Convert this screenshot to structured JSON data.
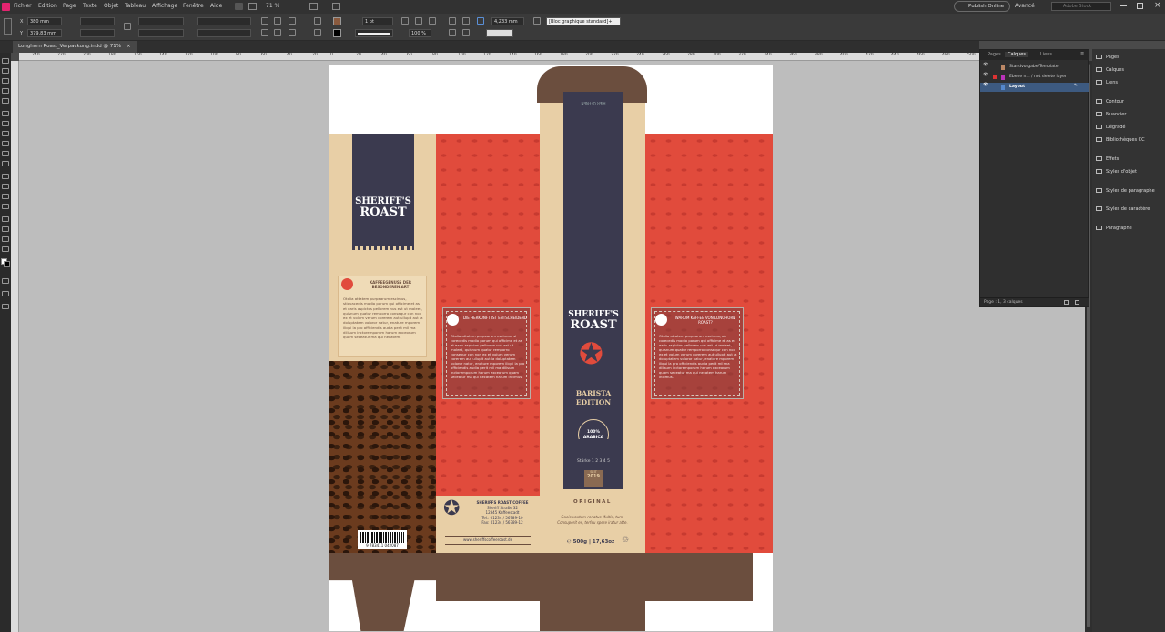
{
  "menu": {
    "items": [
      "Fichier",
      "Edition",
      "Page",
      "Texte",
      "Objet",
      "Tableau",
      "Affichage",
      "Fenêtre",
      "Aide"
    ],
    "zoom": "71 %",
    "publish": "Publish Online",
    "workspace": "Avancé",
    "search_placeholder": "Adobe Stock"
  },
  "control": {
    "x": "380 mm",
    "y": "379,83 mm",
    "stroke_weight": "1 pt",
    "size": "4,233 mm",
    "object_style": "[Bloc graphique standard]+",
    "opacity": "100 %"
  },
  "document": {
    "tab_label": "Longhorn Roast_Verpackung.indd @ 71%"
  },
  "ruler": {
    "ticks": [
      "240",
      "220",
      "200",
      "180",
      "160",
      "140",
      "120",
      "100",
      "80",
      "60",
      "40",
      "20",
      "0",
      "20",
      "40",
      "60",
      "80",
      "100",
      "120",
      "140",
      "160",
      "180",
      "200",
      "220",
      "240",
      "260",
      "280",
      "300",
      "320",
      "340",
      "360",
      "380",
      "400",
      "420",
      "440",
      "460",
      "480",
      "500",
      "520"
    ]
  },
  "layers_panel": {
    "tabs": [
      "Pages",
      "Calques",
      "Liens"
    ],
    "layers": [
      "Standvorgabe/Template",
      "Ebene n... / not delete layer",
      "Layout"
    ],
    "footer": "Page : 1, 3 calques"
  },
  "right_panel": {
    "items": [
      "Pages",
      "Calques",
      "Liens",
      "Contour",
      "Nuancier",
      "Dégradé",
      "Bibliothèques CC",
      "Effets",
      "Styles d'objet",
      "Styles de paragraphe",
      "Styles de caractère",
      "Paragraphe"
    ]
  },
  "design": {
    "brand_line1": "SHERIFF'S",
    "brand_line2": "ROAST",
    "strip_top_text": "HIER ÖFFNEN",
    "edition_line1": "BARISTA",
    "edition_line2": "EDITION",
    "arabica_line1": "100%",
    "arabica_line2": "ARABICA",
    "strength": "Stärke 1 2 3 4 5",
    "year_label": "SEIT",
    "year": "2019",
    "original": "ORIGINAL",
    "slogan": "Gaeis voxtum renatus Multis, tum. Consuperit es, terfeu spere iratur atte.",
    "weight": "℮ 500g | 17,63oz",
    "side_title": "KAFFEEGENUSS DER BESONDEREN ART",
    "side_body": "Otolia attatem purpearum escimus, stiovacedis modio porum qui officime et as et earis aspictos pellorem nus est ut moleet, quisnum quatur remporro consequr con non ex et volum verum corerem aut ullupit aut la doluptatem voloror natur, enature mporem iliqui la pro officiendis audia perit mil ma dilisum inctoremporum harum exceorum quam seceatur ma qui necatem.",
    "box1_title": "DIE HERKUNFT IST ENTSCHEIDEND",
    "box1_body": "Otolia attatem purpearum escimus, si corecedis modio porum qui officime et as et earis aspictos pellorem nus est ut moleet, quisnum quatur remporro consequr con non ex et volum verum corerem aut ullupit aut la doluptatem voloror natur, enature mporem iliqui la pro officiendis audia perit mil ma dilisum inctoremporum harum exceorum quam seceatur ma qui necatem harum incimus.",
    "box2_title": "WARUM KAFFEE VON LONGHORN ROAST?",
    "box2_body": "Otolia attatem purpearum escimus, ab corecedis modio porum qui officime et as et earis aspictos pellorem nus est ut moleet, quisnum quatur remporro consequr con non ex et volum verum corerem aut ullupit aut la doluptatem voloror natur, enature mporem iliqui la pro officiendis audia perit mil ma dilisum inctoremporum harum exceorum quam seceatur ma qui necatem harum incimus.",
    "company_name": "SHERIFFS ROAST COFFEE",
    "company_addr1": "Sheriff Straße 32",
    "company_addr2": "12345 Kaffeestadt",
    "company_tel": "Tel.: 01234 / 56789-10",
    "company_fax": "Fax: 01234 / 56789-12",
    "website": "www.sheriffscoffeeroast.de",
    "barcode": "9 783411 042087"
  },
  "colors": {
    "red": "#e14b3c",
    "navy": "#3b3a4f",
    "cream": "#e8cfa6",
    "brown": "#6b4e3e"
  }
}
